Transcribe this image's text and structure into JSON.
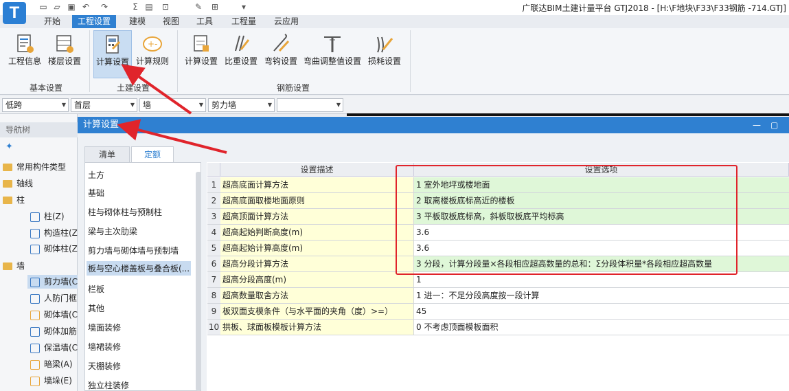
{
  "app": {
    "logo": "T",
    "title": "广联达BIM土建计量平台 GTJ2018 - [H:\\F地块\\F33\\F33钢筋 -714.GTJ]"
  },
  "quick_access": [
    "new-file-icon",
    "open-folder-icon",
    "save-icon",
    "undo-icon",
    "redo-icon",
    "sum-icon",
    "report-icon",
    "view-icon",
    "pencil-icon",
    "grid-icon",
    "more-icon"
  ],
  "menu_tabs": [
    "开始",
    "工程设置",
    "建模",
    "视图",
    "工具",
    "工程量",
    "云应用"
  ],
  "ribbon": {
    "groups": [
      {
        "label": "基本设置",
        "buttons": [
          {
            "label": "工程信息",
            "icon": "project-info-icon"
          },
          {
            "label": "楼层设置",
            "icon": "floor-settings-icon"
          }
        ]
      },
      {
        "label": "土建设置",
        "buttons": [
          {
            "label": "计算设置",
            "icon": "calc-settings-icon"
          },
          {
            "label": "计算规则",
            "icon": "calc-rules-icon"
          }
        ]
      },
      {
        "label": "钢筋设置",
        "buttons": [
          {
            "label": "计算设置",
            "icon": "rebar-calc-icon"
          },
          {
            "label": "比重设置",
            "icon": "density-icon"
          },
          {
            "label": "弯钩设置",
            "icon": "hook-icon"
          },
          {
            "label": "弯曲调整值设置",
            "icon": "bend-icon"
          },
          {
            "label": "损耗设置",
            "icon": "loss-icon"
          }
        ]
      }
    ]
  },
  "combos": [
    "低跨",
    "首层",
    "墙",
    "剪力墙",
    ""
  ],
  "nav": {
    "header": "导航树",
    "items": [
      "常用构件类型",
      "轴线",
      "柱",
      "柱(Z)",
      "构造柱(Z",
      "砌体柱(Z)",
      "墙",
      "剪力墙(C",
      "人防门框",
      "砌体墙(C",
      "砌体加筋",
      "保温墙(C",
      "暗梁(A)",
      "墙垛(E)"
    ]
  },
  "dialog": {
    "title": "计算设置",
    "tabs": [
      "清单",
      "定额"
    ]
  },
  "categories": [
    "土方",
    "基础",
    "柱与砌体柱与预制柱",
    "梁与主次肋梁",
    "剪力墙与砌体墙与预制墙",
    "板与空心楼盖板与叠合板(...",
    "栏板",
    "其他",
    "墙面装修",
    "墙裙装修",
    "天棚装修",
    "独立柱装修"
  ],
  "table": {
    "headers": [
      "设置描述",
      "设置选项"
    ],
    "rows": [
      {
        "n": "1",
        "desc": "超高底面计算方法",
        "opt": "1 室外地坪或楼地面"
      },
      {
        "n": "2",
        "desc": "超高底面取楼地面原则",
        "opt": "2 取离楼板底标高近的楼板"
      },
      {
        "n": "3",
        "desc": "超高顶面计算方法",
        "opt": "3 平板取板底标高，斜板取板底平均标高"
      },
      {
        "n": "4",
        "desc": "超高起始判断高度(m)",
        "opt": "3.6"
      },
      {
        "n": "5",
        "desc": "超高起始计算高度(m)",
        "opt": "3.6"
      },
      {
        "n": "6",
        "desc": "超高分段计算方法",
        "opt": "3 分段，计算分段量×各段相应超高数量的总和：Σ分段体积量*各段相应超高数量"
      },
      {
        "n": "7",
        "desc": "超高分段高度(m)",
        "opt": "1"
      },
      {
        "n": "8",
        "desc": "超高数量取舍方法",
        "opt": "1 进一：不足分段高度按一段计算"
      },
      {
        "n": "9",
        "desc": "板双面支模条件（与水平面的夹角（度）>=）",
        "opt": "45"
      },
      {
        "n": "10",
        "desc": "拱板、球面板模板计算方法",
        "opt": "0 不考虑顶面模板面积"
      }
    ]
  },
  "colors": {
    "accent": "#2f80d1",
    "highlight_box": "#e0242b",
    "row_green": "#dff7d8",
    "row_yellow": "#ffffd8"
  }
}
